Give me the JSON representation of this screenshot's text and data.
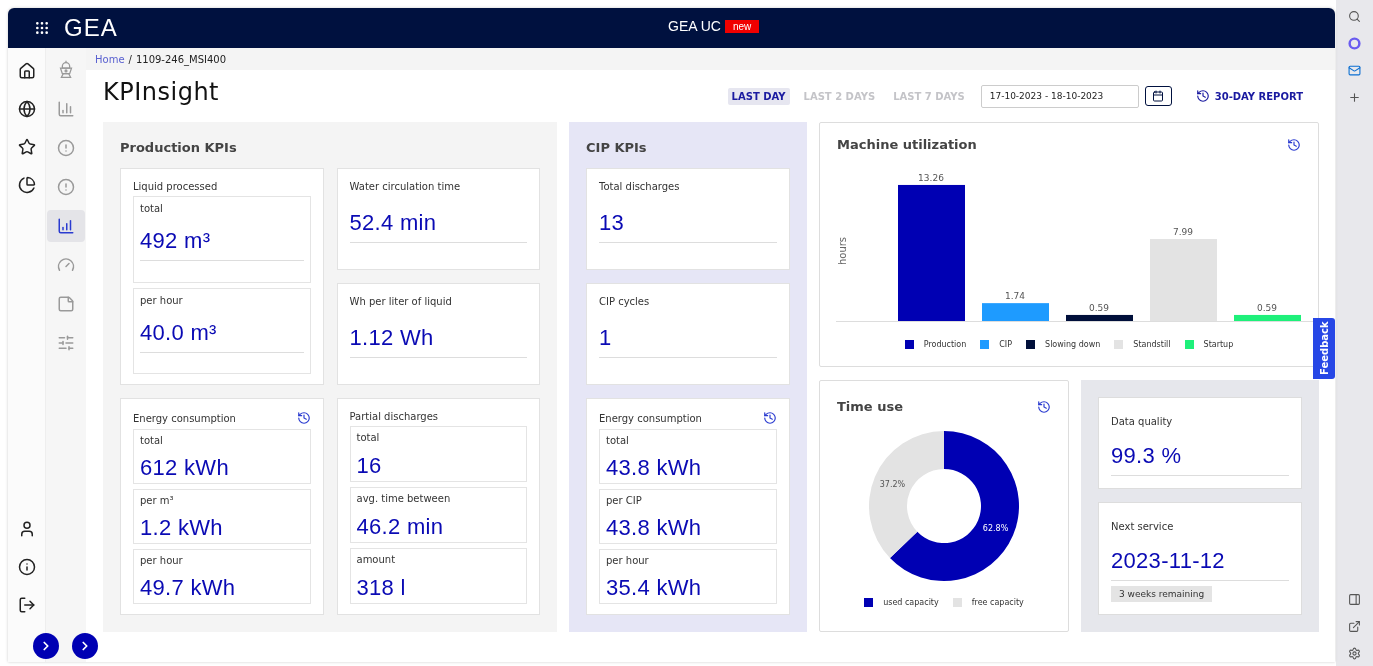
{
  "app_bar": {
    "logo": "GEA",
    "title": "GEA UC",
    "badge": "new"
  },
  "sub_nav": [
    {
      "selected": false
    },
    {
      "selected": false
    },
    {
      "selected": false
    },
    {
      "selected": false
    },
    {
      "selected": true
    },
    {
      "selected": false
    },
    {
      "selected": false
    },
    {
      "selected": false
    }
  ],
  "breadcrumb": {
    "items": [
      "Home",
      "1109-246_MSI400"
    ],
    "separator": "/"
  },
  "title": "KPInsight",
  "ranges": [
    {
      "label": "LAST DAY",
      "selected": true
    },
    {
      "label": "LAST 2 DAYS",
      "selected": false
    },
    {
      "label": "LAST 7 DAYS",
      "selected": false
    }
  ],
  "date_range": {
    "value": "17-10-2023 - 18-10-2023"
  },
  "report_button": "30-DAY REPORT",
  "production": {
    "title": "Production KPIs",
    "cards": [
      {
        "kind": "stacked",
        "title": "Liquid processed",
        "history": false,
        "metrics": [
          {
            "label": "total",
            "value": "492 m³"
          },
          {
            "label": "per hour",
            "value": "40.0 m³"
          }
        ]
      },
      {
        "kind": "single",
        "title": "Water circulation time",
        "value": "52.4 min"
      },
      {
        "kind": "single",
        "title": "Wh per liter of liquid",
        "value": "1.12 Wh"
      },
      {
        "kind": "compact",
        "title": "Energy consumption",
        "history": true,
        "metrics": [
          {
            "label": "total",
            "value": "612 kWh"
          },
          {
            "label": "per m³",
            "value": "1.2 kWh"
          },
          {
            "label": "per hour",
            "value": "49.7 kWh"
          }
        ]
      },
      {
        "kind": "compact",
        "title": "Partial discharges",
        "history": false,
        "metrics": [
          {
            "label": "total",
            "value": "16"
          },
          {
            "label": "avg. time between",
            "value": "46.2 min"
          },
          {
            "label": "amount",
            "value": "318 l"
          }
        ]
      }
    ]
  },
  "cip": {
    "title": "CIP KPIs",
    "cards": [
      {
        "kind": "single",
        "title": "Total discharges",
        "value": "13"
      },
      {
        "kind": "single",
        "title": "CIP cycles",
        "value": "1"
      },
      {
        "kind": "compact",
        "title": "Energy consumption",
        "history": true,
        "metrics": [
          {
            "label": "total",
            "value": "43.8 kWh"
          },
          {
            "label": "per CIP",
            "value": "43.8 kWh"
          },
          {
            "label": "per hour",
            "value": "35.4 kWh"
          }
        ]
      }
    ]
  },
  "machine_utilization": {
    "title": "Machine utilization",
    "chart_data": {
      "type": "bar",
      "ylabel": "hours",
      "series": [
        {
          "name": "Production",
          "color": "#0000b3",
          "values": [
            13.26
          ]
        },
        {
          "name": "CIP",
          "color": "#1e9bff",
          "values": [
            1.74
          ]
        },
        {
          "name": "Slowing down",
          "color": "#000f3a",
          "values": [
            0.59
          ]
        },
        {
          "name": "Standstill",
          "color": "#e3e3e3",
          "values": [
            7.99
          ]
        },
        {
          "name": "Startup",
          "color": "#1ef07a",
          "values": [
            0.59
          ]
        }
      ],
      "data_labels": true
    }
  },
  "time_use": {
    "title": "Time use",
    "chart_data": {
      "type": "donut",
      "categories": [
        "used capacity",
        "free capacity"
      ],
      "values": [
        62.8,
        37.2
      ],
      "colors": [
        "#0000b3",
        "#e3e3e3"
      ],
      "value_labels": [
        "62.8%",
        "37.2%"
      ]
    }
  },
  "status": {
    "cards": [
      {
        "title": "Data quality",
        "value": "99.3 %"
      },
      {
        "title": "Next service",
        "value": "2023-11-12",
        "note": "3 weeks remaining"
      }
    ]
  },
  "feedback": "Feedback"
}
